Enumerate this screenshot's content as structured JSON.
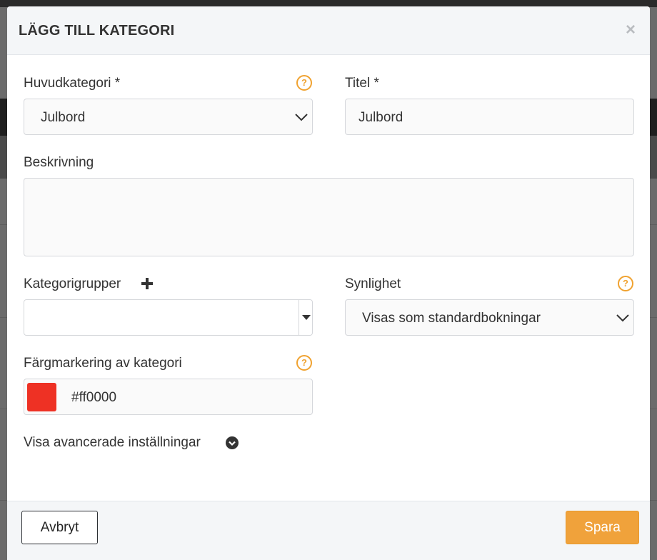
{
  "modal": {
    "title": "LÄGG TILL KATEGORI",
    "close_icon": "×"
  },
  "fields": {
    "main_category": {
      "label": "Huvudkategori *",
      "value": "Julbord",
      "help": "?"
    },
    "title": {
      "label": "Titel *",
      "value": "Julbord"
    },
    "description": {
      "label": "Beskrivning",
      "value": ""
    },
    "category_groups": {
      "label": "Kategorigrupper",
      "add_icon": "plus-icon",
      "value": ""
    },
    "visibility": {
      "label": "Synlighet",
      "value": "Visas som standardbokningar",
      "help": "?"
    },
    "color": {
      "label": "Färgmarkering av kategori",
      "value": "#ff0000",
      "swatch_color": "#ee3124",
      "help": "?"
    },
    "advanced": {
      "label": "Visa avancerade inställningar"
    }
  },
  "footer": {
    "cancel_label": "Avbryt",
    "save_label": "Spara"
  },
  "colors": {
    "accent": "#f0a23b",
    "help": "#f0a230"
  }
}
